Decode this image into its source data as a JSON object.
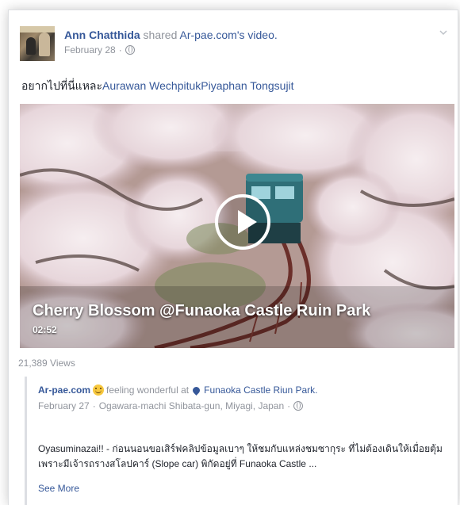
{
  "post": {
    "author": "Ann Chatthida",
    "action": "shared",
    "source": "Ar-pae.com",
    "object": "'s video.",
    "date": "February 28",
    "text": "อยากไปที่นี่แหละ",
    "tags": [
      "Aurawan Wechpituk",
      "Piyaphan Tongsujit"
    ]
  },
  "video": {
    "title": "Cherry Blossom @Funaoka Castle Ruin Park",
    "duration": "02:52",
    "views": "21,389 Views"
  },
  "shared_post": {
    "page": "Ar-pae.com",
    "feeling": "feeling wonderful at",
    "place": "Funaoka Castle Riun Park.",
    "date": "February 27",
    "location": "Ogawara-machi Shibata-gun, Miyagi, Japan",
    "description": "Oyasuminazai!! - ก่อนนอนขอเสิร์ฟคลิปข้อมูลเบาๆ ให้ชมกับแหล่งชมซากุระ ที่ไม่ต้องเดินให้เมื่อยตุ้มเพราะมีเจ้ารถรางสโลปคาร์ (Slope car) พิกัดอยู่ที่ Funaoka Castle ...",
    "see_more": "See More"
  },
  "icons": {
    "privacy": "globe-icon",
    "menu": "chevron-down-icon",
    "play": "play-icon",
    "feeling": "smile-emoji-icon",
    "location": "location-pin-icon"
  },
  "colors": {
    "link": "#365899",
    "muted": "#90949c",
    "text": "#1d2129"
  }
}
